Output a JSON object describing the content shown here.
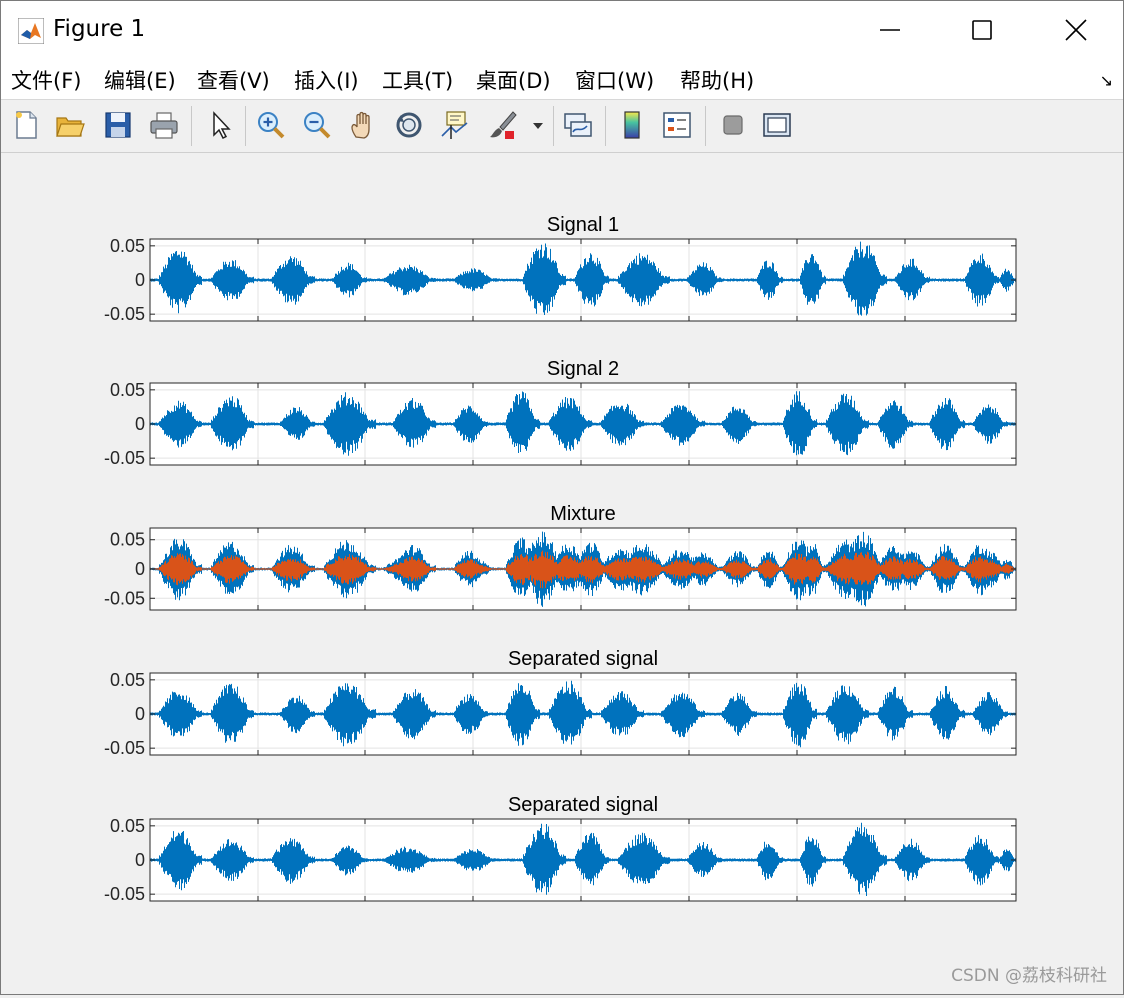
{
  "window": {
    "title": "Figure 1",
    "buttons": [
      "minimize",
      "maximize",
      "close"
    ]
  },
  "menu": {
    "items": [
      "文件(F)",
      "编辑(E)",
      "查看(V)",
      "插入(I)",
      "工具(T)",
      "桌面(D)",
      "窗口(W)",
      "帮助(H)"
    ],
    "corner_arrow": "↘"
  },
  "toolbar": {
    "icons": [
      "new-figure-icon",
      "open-file-icon",
      "save-icon",
      "print-icon",
      "select-arrow-icon",
      "zoom-in-icon",
      "zoom-out-icon",
      "pan-hand-icon",
      "rotate-3d-icon",
      "data-cursor-icon",
      "brush-icon",
      "brush-dropdown-icon",
      "link-plot-icon",
      "colorbar-icon",
      "legend-icon",
      "hide-plot-tools-icon",
      "show-plot-tools-icon"
    ]
  },
  "colors": {
    "blue": "#0072BD",
    "orange": "#D95319"
  },
  "chart_data": [
    {
      "type": "line",
      "title": "Signal 1",
      "yticks": [
        "0.05",
        "0",
        "-0.05"
      ],
      "ylim": [
        -0.06,
        0.06
      ],
      "xlim": [
        0,
        1
      ],
      "grid": true,
      "series": [
        {
          "color": "#0072BD"
        }
      ]
    },
    {
      "type": "line",
      "title": "Signal 2",
      "yticks": [
        "0.05",
        "0",
        "-0.05"
      ],
      "ylim": [
        -0.06,
        0.06
      ],
      "xlim": [
        0,
        1
      ],
      "grid": true,
      "series": [
        {
          "color": "#0072BD"
        }
      ]
    },
    {
      "type": "line",
      "title": "Mixture",
      "yticks": [
        "0.05",
        "0",
        "-0.05"
      ],
      "ylim": [
        -0.07,
        0.07
      ],
      "xlim": [
        0,
        1
      ],
      "grid": true,
      "series": [
        {
          "color": "#0072BD"
        },
        {
          "color": "#D95319"
        }
      ]
    },
    {
      "type": "line",
      "title": "Separated signal",
      "yticks": [
        "0.05",
        "0",
        "-0.05"
      ],
      "ylim": [
        -0.06,
        0.06
      ],
      "xlim": [
        0,
        1
      ],
      "grid": true,
      "series": [
        {
          "color": "#0072BD"
        }
      ]
    },
    {
      "type": "line",
      "title": "Separated signal",
      "yticks": [
        "0.05",
        "0",
        "-0.05"
      ],
      "ylim": [
        -0.06,
        0.06
      ],
      "xlim": [
        0,
        1
      ],
      "grid": true,
      "series": [
        {
          "color": "#0072BD"
        }
      ]
    }
  ],
  "watermark": "CSDN @荔枝科研社"
}
